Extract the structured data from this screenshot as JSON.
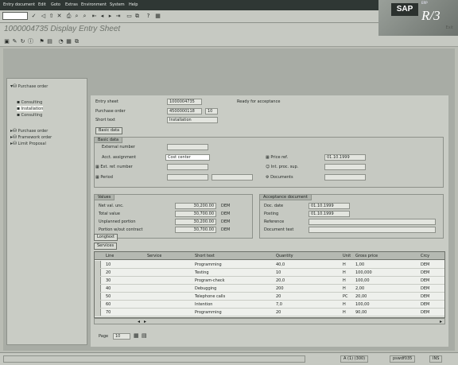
{
  "menubar": {
    "items": [
      "Entry document",
      "Edit",
      "Goto",
      "Extras",
      "Environment",
      "System",
      "Help"
    ]
  },
  "toolbar": {
    "command": "",
    "icons": [
      "check-icon",
      "back-icon",
      "exit-icon",
      "cancel-icon",
      "print-icon",
      "find-icon",
      "find-next-icon",
      "first-page-icon",
      "prev-page-icon",
      "next-page-icon",
      "last-page-icon",
      "create-session-icon",
      "shortcut-icon",
      "help-icon",
      "layout-icon"
    ]
  },
  "logo": {
    "brand": "SAP",
    "product": "R/3",
    "tag": "ERP"
  },
  "title": {
    "text": "1000004735 Display Entry Sheet",
    "exit": "Exit"
  },
  "tree": {
    "root": "Purchase order",
    "items": [
      {
        "label": "Consulting",
        "selected": false
      },
      {
        "label": "Installation",
        "selected": true
      },
      {
        "label": "Consulting",
        "selected": false
      }
    ],
    "nodes": [
      {
        "label": "Purchase order"
      },
      {
        "label": "Framework order"
      },
      {
        "label": "Limit Proposal"
      }
    ]
  },
  "header": {
    "entry_sheet_label": "Entry sheet",
    "entry_sheet_value": "1000004735",
    "status_text": "Ready for acceptance",
    "po_label": "Purchase order",
    "po_value": "4500000118",
    "po_item": "10",
    "short_text_label": "Short text",
    "short_text_value": "Installation",
    "basic_data_btn": "Basic data"
  },
  "basic_data": {
    "tab": "Basic data",
    "ext_number_label": "External number",
    "acct_label": "Acct. assignment",
    "acct_value": "Cost center",
    "doc_date_label": "Price ref.",
    "doc_date_value": "01.10.1999",
    "ext_ref_label": "Ext. ref. number",
    "person_label": "Int. proc. sup.",
    "period_label": "Period",
    "doc_label": "Documents"
  },
  "values": {
    "title": "Values",
    "rows": [
      {
        "label": "Net val. unc.",
        "amount": "30,200.00",
        "currency": "DEM"
      },
      {
        "label": "Total value",
        "amount": "30,700.00",
        "currency": "DEM"
      },
      {
        "label": "Unplanned portion",
        "amount": "30,200.00",
        "currency": "DEM"
      },
      {
        "label": "Portion w/out contract",
        "amount": "30,700.00",
        "currency": "DEM"
      }
    ]
  },
  "acceptance": {
    "title": "Acceptance document",
    "rows": [
      {
        "label": "Doc. date",
        "value": "01.10.1999"
      },
      {
        "label": "Posting",
        "value": "01.10.1999"
      },
      {
        "label": "Reference",
        "value": ""
      },
      {
        "label": "Document text",
        "value": ""
      }
    ]
  },
  "buttons": {
    "longtext": "Longtext",
    "services": "Services",
    "page_label": "Page",
    "page_value": "10"
  },
  "grid": {
    "columns": [
      "Line",
      "Service",
      "Short text",
      "Quantity",
      "Unit",
      "Gross price",
      "Crcy"
    ],
    "rows": [
      {
        "line": "10",
        "service": "",
        "text": "Programming",
        "qty": "40,0",
        "unit": "H",
        "price": "1,00",
        "crcy": "DEM"
      },
      {
        "line": "20",
        "service": "",
        "text": "Testing",
        "qty": "10",
        "unit": "H",
        "price": "100,000",
        "crcy": "DEM"
      },
      {
        "line": "30",
        "service": "",
        "text": "Program-check",
        "qty": "20,0",
        "unit": "H",
        "price": "100,00",
        "crcy": "DEM"
      },
      {
        "line": "40",
        "service": "",
        "text": "Debugging",
        "qty": "200",
        "unit": "H",
        "price": "2,00",
        "crcy": "DEM"
      },
      {
        "line": "50",
        "service": "",
        "text": "Telephone calls",
        "qty": "20",
        "unit": "PC",
        "price": "20,00",
        "crcy": "DEM"
      },
      {
        "line": "60",
        "service": "",
        "text": "Intention",
        "qty": "7,0",
        "unit": "H",
        "price": "100,00",
        "crcy": "DEM"
      },
      {
        "line": "70",
        "service": "",
        "text": "Programming",
        "qty": "20",
        "unit": "H",
        "price": "90,00",
        "crcy": "DEM"
      }
    ]
  },
  "status": {
    "system": "A (1) (300)",
    "server": "pswdf035",
    "mode": "INS"
  }
}
